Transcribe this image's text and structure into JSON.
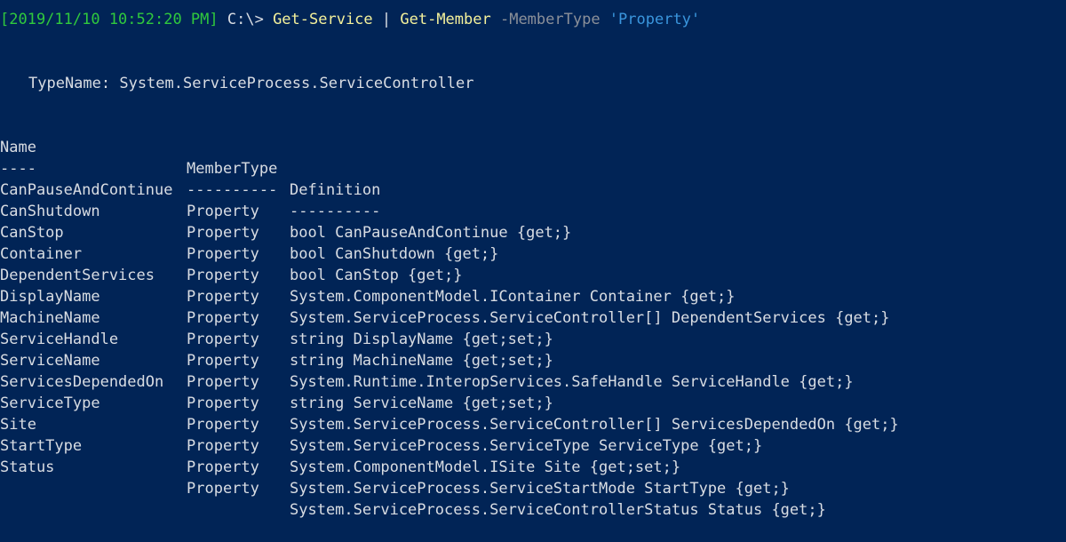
{
  "prompt": {
    "timestamp": "[2019/11/10 10:52:20 PM]",
    "path": " C:\\> ",
    "command1": "Get-Service",
    "pipe": " | ",
    "command2": "Get-Member",
    "param": " -MemberType ",
    "argument": "'Property'"
  },
  "typename": {
    "label": "TypeName: System.ServiceProcess.ServiceController"
  },
  "table": {
    "headers": [
      "Name",
      "MemberType",
      "Definition"
    ],
    "separators": [
      "----",
      "----------",
      "----------"
    ],
    "rows": [
      {
        "name": "CanPauseAndContinue",
        "type": "Property",
        "def": "bool CanPauseAndContinue {get;}"
      },
      {
        "name": "CanShutdown",
        "type": "Property",
        "def": "bool CanShutdown {get;}"
      },
      {
        "name": "CanStop",
        "type": "Property",
        "def": "bool CanStop {get;}"
      },
      {
        "name": "Container",
        "type": "Property",
        "def": "System.ComponentModel.IContainer Container {get;}"
      },
      {
        "name": "DependentServices",
        "type": "Property",
        "def": "System.ServiceProcess.ServiceController[] DependentServices {get;}"
      },
      {
        "name": "DisplayName",
        "type": "Property",
        "def": "string DisplayName {get;set;}"
      },
      {
        "name": "MachineName",
        "type": "Property",
        "def": "string MachineName {get;set;}"
      },
      {
        "name": "ServiceHandle",
        "type": "Property",
        "def": "System.Runtime.InteropServices.SafeHandle ServiceHandle {get;}"
      },
      {
        "name": "ServiceName",
        "type": "Property",
        "def": "string ServiceName {get;set;}"
      },
      {
        "name": "ServicesDependedOn",
        "type": "Property",
        "def": "System.ServiceProcess.ServiceController[] ServicesDependedOn {get;}"
      },
      {
        "name": "ServiceType",
        "type": "Property",
        "def": "System.ServiceProcess.ServiceType ServiceType {get;}"
      },
      {
        "name": "Site",
        "type": "Property",
        "def": "System.ComponentModel.ISite Site {get;set;}"
      },
      {
        "name": "StartType",
        "type": "Property",
        "def": "System.ServiceProcess.ServiceStartMode StartType {get;}"
      },
      {
        "name": "Status",
        "type": "Property",
        "def": "System.ServiceProcess.ServiceControllerStatus Status {get;}"
      }
    ]
  },
  "colors": {
    "background": "#012456",
    "text": "#d9dde3",
    "timestamp": "#30c93d",
    "command": "#f4f19b",
    "parameter": "#8b9099",
    "string": "#3a96dd"
  }
}
